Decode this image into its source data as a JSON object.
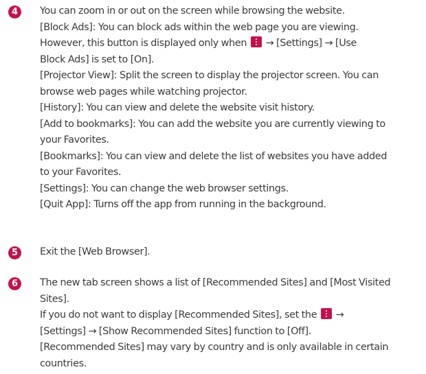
{
  "icons": {
    "badge_color": "#c5124a",
    "menu_icon": "more-vertical-icon"
  },
  "step4": {
    "number": "4",
    "l1": "You can zoom in or out on the screen while browsing the website.",
    "l2": "[Block Ads]: You can block ads within the web page you are viewing.",
    "l3a": "However, this button is displayed only when",
    "l3b": "→ [Settings] → [Use",
    "l4": "Block Ads] is set to [On].",
    "l5": "[Projector View]: Split the screen to display the projector screen. You can",
    "l6": "browse web pages while watching projector.",
    "l7": "[History]: You can view and delete the website visit history.",
    "l8": "[Add to bookmarks]: You can add the website you are currently viewing to",
    "l9": "your Favorites.",
    "l10": "[Bookmarks]: You can view and delete the list of websites you have added",
    "l11": "to your Favorites.",
    "l12": "[Settings]: You can change the web browser settings.",
    "l13": "[Quit App]: Turns off the app from running in the background."
  },
  "step5": {
    "number": "5",
    "l1": "Exit the [Web Browser]."
  },
  "step6": {
    "number": "6",
    "l1": "The new tab screen shows a list of [Recommended Sites] and [Most Visited",
    "l2": "Sites].",
    "l3a": "If you do not want to display [Recommended Sites], set the",
    "l3b": "→",
    "l4": "[Settings] → [Show Recommended Sites] function to [Off].",
    "l5": "[Recommended Sites] may vary by country and is only available in certain",
    "l6": "countries."
  }
}
